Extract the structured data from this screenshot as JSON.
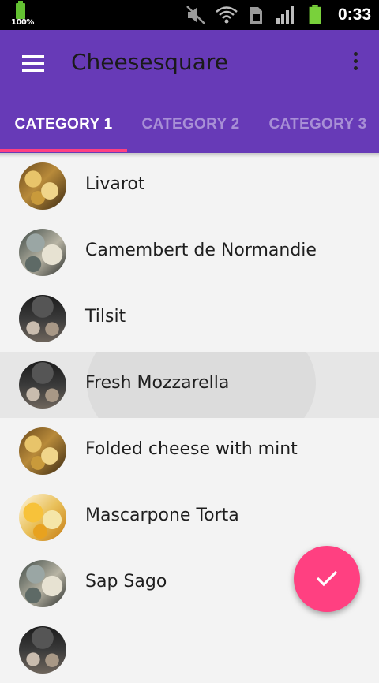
{
  "status_bar": {
    "battery_percent": "100%",
    "time": "0:33"
  },
  "app_bar": {
    "title": "Cheesesquare",
    "menu_icon": "hamburger-menu-icon",
    "overflow_icon": "more-vert-icon"
  },
  "tabs": [
    {
      "label": "CATEGORY 1",
      "active": true
    },
    {
      "label": "CATEGORY 2",
      "active": false
    },
    {
      "label": "CATEGORY 3",
      "active": false
    }
  ],
  "cheeses": [
    {
      "name": "Livarot",
      "avatar": "yellow"
    },
    {
      "name": "Camembert de Normandie",
      "avatar": "grey"
    },
    {
      "name": "Tilsit",
      "avatar": "dark"
    },
    {
      "name": "Fresh Mozzarella",
      "avatar": "dark",
      "pressed": true
    },
    {
      "name": "Folded cheese with mint",
      "avatar": "yellow"
    },
    {
      "name": "Mascarpone Torta",
      "avatar": "orange"
    },
    {
      "name": "Sap Sago",
      "avatar": "grey"
    },
    {
      "name": "",
      "avatar": "dark"
    }
  ],
  "fab": {
    "icon": "check-icon"
  },
  "colors": {
    "primary": "#673ab7",
    "accent": "#ff4081",
    "background": "#f3f3f3"
  }
}
